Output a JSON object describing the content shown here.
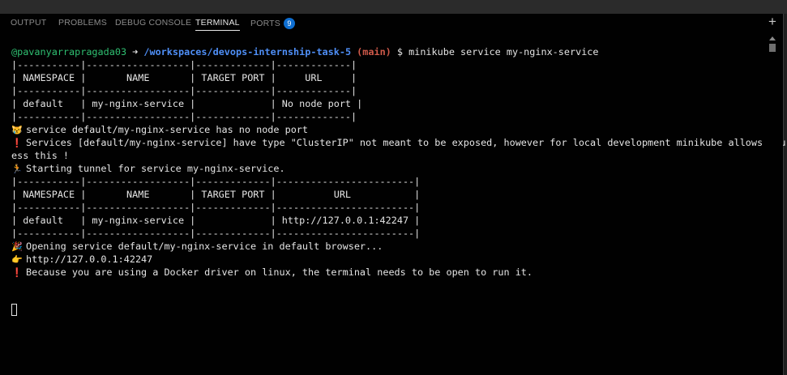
{
  "tabs": [
    {
      "label": "OUTPUT"
    },
    {
      "label": "PROBLEMS"
    },
    {
      "label": "DEBUG CONSOLE"
    },
    {
      "label": "TERMINAL"
    },
    {
      "label": "PORTS",
      "badge": "9"
    }
  ],
  "new_terminal_label": "+",
  "prompt": {
    "user": "@pavanyarrapragada03",
    "arrow": "➜",
    "path": "/workspaces/devops-internship-task-5",
    "branch": "(main)",
    "symbol": "$",
    "command": "minikube service my-nginx-service"
  },
  "table1": [
    "|-----------|------------------|-------------|-------------|",
    "| NAMESPACE |       NAME       | TARGET PORT |     URL     |",
    "|-----------|------------------|-------------|-------------|",
    "| default   | my-nginx-service |             | No node port |",
    "|-----------|------------------|-------------|-------------|"
  ],
  "messages1": [
    {
      "icon": "😿",
      "icon_name": "crying-cat-icon",
      "text": "service default/my-nginx-service has no node port"
    },
    {
      "icon": "❗",
      "icon_name": "exclamation-icon",
      "text": "Services [default/my-nginx-service] have type \"ClusterIP\" not meant to be exposed, however for local development minikube allows you to acc"
    },
    {
      "icon": "",
      "icon_name": "",
      "text": "ess this !"
    },
    {
      "icon": "🏃",
      "icon_name": "running-icon",
      "text": "Starting tunnel for service my-nginx-service."
    }
  ],
  "table2": [
    "|-----------|------------------|-------------|------------------------|",
    "| NAMESPACE |       NAME       | TARGET PORT |          URL           |",
    "|-----------|------------------|-------------|------------------------|",
    "| default   | my-nginx-service |             | http://127.0.0.1:42247 |",
    "|-----------|------------------|-------------|------------------------|"
  ],
  "messages2": [
    {
      "icon": "🎉",
      "icon_name": "party-popper-icon",
      "text": "Opening service default/my-nginx-service in default browser..."
    },
    {
      "icon": "👉",
      "icon_name": "pointing-hand-icon",
      "text": "http://127.0.0.1:42247"
    },
    {
      "icon": "❗",
      "icon_name": "exclamation-icon",
      "text": "Because you are using a Docker driver on linux, the terminal needs to be open to run it."
    }
  ]
}
